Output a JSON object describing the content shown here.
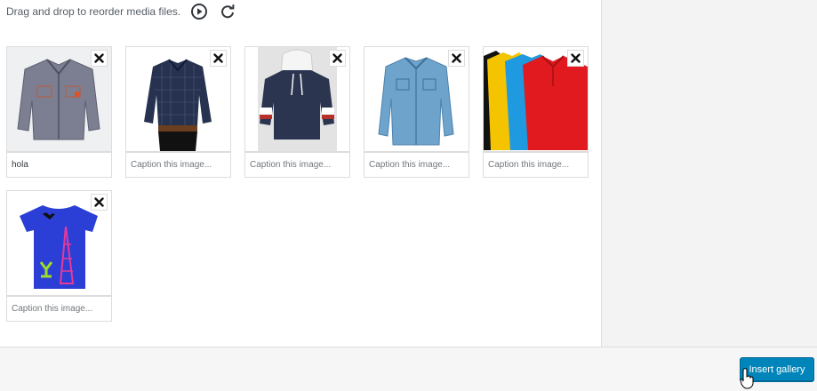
{
  "instructions": {
    "text": "Drag and drop to reorder media files.",
    "play_icon": "play-circle-icon",
    "refresh_icon": "refresh-icon"
  },
  "gallery": {
    "items": [
      {
        "image": "grey work jacket",
        "caption_value": "hola",
        "caption_placeholder": "Caption this image..."
      },
      {
        "image": "navy checked shirt",
        "caption_value": "",
        "caption_placeholder": "Caption this image..."
      },
      {
        "image": "navy hoodie",
        "caption_value": "",
        "caption_placeholder": "Caption this image..."
      },
      {
        "image": "denim shirt",
        "caption_value": "",
        "caption_placeholder": "Caption this image..."
      },
      {
        "image": "colored polo shirts",
        "caption_value": "",
        "caption_placeholder": "Caption this image..."
      },
      {
        "image": "blue graphic t-shirt",
        "caption_value": "",
        "caption_placeholder": "Caption this image..."
      }
    ],
    "remove_icon": "close-icon"
  },
  "toolbar": {
    "insert_label": "Insert gallery"
  },
  "colors": {
    "primary_button": "#0085ba",
    "sidebar_bg": "#f3f3f3",
    "border": "#dddddd"
  }
}
